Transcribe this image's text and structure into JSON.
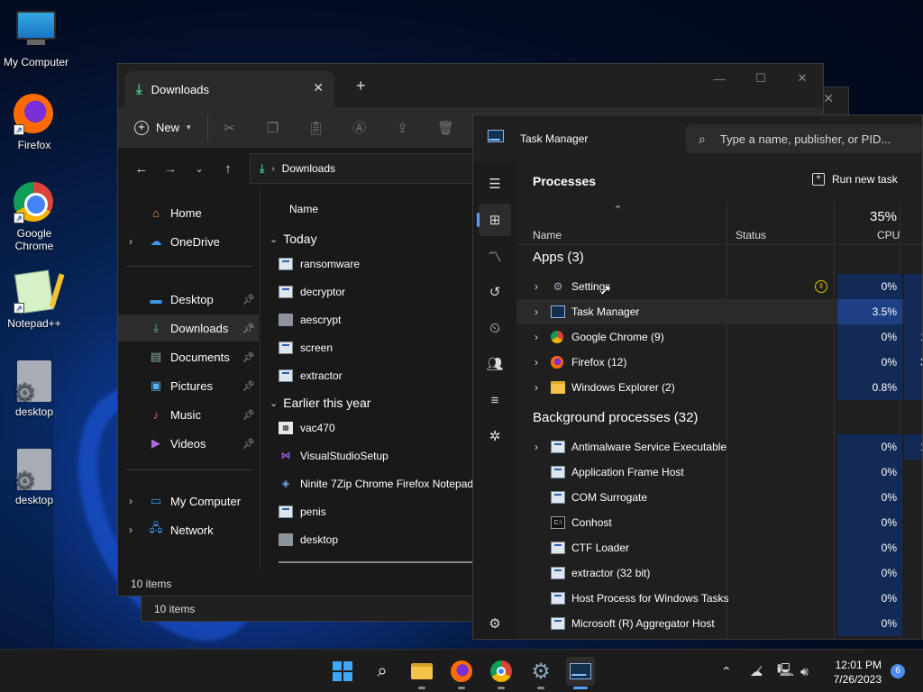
{
  "desktop": {
    "icons": [
      {
        "label": "My Computer"
      },
      {
        "label": "Firefox"
      },
      {
        "label": "Google Chrome"
      },
      {
        "label": "Notepad++"
      },
      {
        "label": "desktop"
      },
      {
        "label": "desktop"
      }
    ]
  },
  "explorer": {
    "tab_title": "Downloads",
    "toolbar": {
      "new_label": "New"
    },
    "address": {
      "path": "Downloads"
    },
    "nav": [
      {
        "label": "Home"
      },
      {
        "label": "OneDrive"
      },
      {
        "label": "Desktop"
      },
      {
        "label": "Downloads"
      },
      {
        "label": "Documents"
      },
      {
        "label": "Pictures"
      },
      {
        "label": "Music"
      },
      {
        "label": "Videos"
      },
      {
        "label": "My Computer"
      },
      {
        "label": "Network"
      }
    ],
    "column_name": "Name",
    "groups": [
      {
        "label": "Today",
        "files": [
          "ransomware",
          "decryptor",
          "aescrypt",
          "screen",
          "extractor"
        ]
      },
      {
        "label": "Earlier this year",
        "files": [
          "vac470",
          "VisualStudioSetup",
          "Ninite 7Zip Chrome Firefox Notepad",
          "penis",
          "desktop"
        ]
      }
    ],
    "status": "10 items",
    "status_back": "10 items"
  },
  "taskmanager": {
    "title": "Task Manager",
    "search_placeholder": "Type a name, publisher, or PID...",
    "page_title": "Processes",
    "run_new_task": "Run new task",
    "columns": {
      "name": "Name",
      "status": "Status",
      "cpu": "CPU",
      "cpu_total": "35%"
    },
    "apps_header": "Apps (3)",
    "apps": [
      {
        "name": "Settings",
        "cpu": "0%"
      },
      {
        "name": "Task Manager",
        "cpu": "3.5%"
      },
      {
        "name": "Google Chrome (9)",
        "cpu": "0%",
        "mem": "1"
      },
      {
        "name": "Firefox (12)",
        "cpu": "0%",
        "mem": "3"
      },
      {
        "name": "Windows Explorer (2)",
        "cpu": "0.8%"
      }
    ],
    "bg_header": "Background processes (32)",
    "background": [
      {
        "name": "Antimalware Service Executable",
        "cpu": "0%",
        "mem": "1"
      },
      {
        "name": "Application Frame Host",
        "cpu": "0%"
      },
      {
        "name": "COM Surrogate",
        "cpu": "0%"
      },
      {
        "name": "Conhost",
        "cpu": "0%"
      },
      {
        "name": "CTF Loader",
        "cpu": "0%"
      },
      {
        "name": "extractor (32 bit)",
        "cpu": "0%"
      },
      {
        "name": "Host Process for Windows Tasks",
        "cpu": "0%"
      },
      {
        "name": "Microsoft (R) Aggregator Host",
        "cpu": "0%"
      }
    ]
  },
  "taskbar": {
    "time": "12:01 PM",
    "date": "7/26/2023",
    "notifications": "6"
  },
  "colors": {
    "accent": "#5aa0ff",
    "download_green": "#3fc48a",
    "cpu_highlight": "#1d3f84"
  }
}
